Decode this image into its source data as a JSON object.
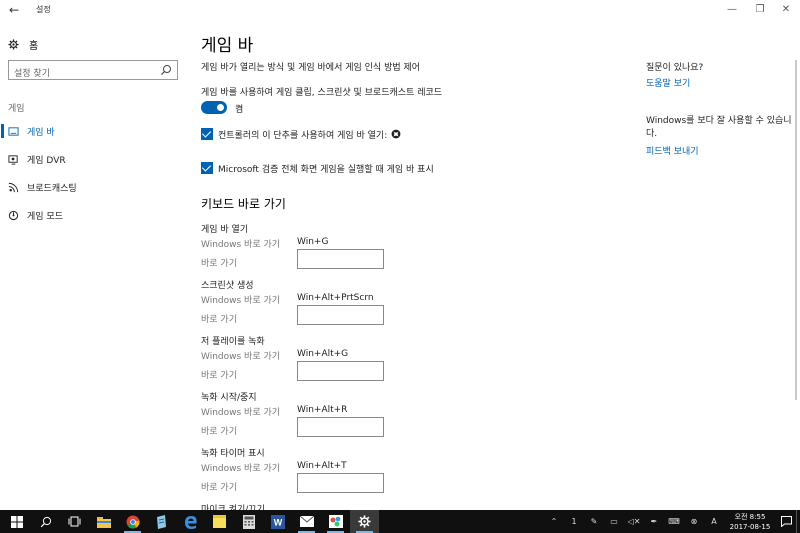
{
  "window": {
    "title": "설정"
  },
  "sidebar": {
    "home_label": "홈",
    "search_placeholder": "설정 찾기",
    "section_label": "게임",
    "items": [
      {
        "label": "게임 바",
        "icon": "game-bar-icon",
        "active": true
      },
      {
        "label": "게임 DVR",
        "icon": "game-dvr-icon",
        "active": false
      },
      {
        "label": "브로드캐스팅",
        "icon": "broadcast-icon",
        "active": false
      },
      {
        "label": "게임 모드",
        "icon": "game-mode-icon",
        "active": false
      }
    ]
  },
  "main": {
    "title": "게임 바",
    "description": "게임 바가 열리는 방식 및 게임 바에서 게임 인식 방법 제어",
    "record_toggle": {
      "label": "게임 바를 사용하여 게임 클립, 스크린샷 및 브로드캐스트 레코드",
      "state": "켬",
      "on": true
    },
    "checkbox_controller": {
      "label": "컨트롤러의 이 단추를 사용하여 게임 바 열기:",
      "checked": true
    },
    "checkbox_fullscreen": {
      "label": "Microsoft 검증 전체 화면 게임을 실행할 때 게임 바 표시",
      "checked": true
    },
    "shortcuts_title": "키보드 바로 가기",
    "windows_shortcut_label": "Windows 바로 가기",
    "custom_shortcut_label": "바로 가기",
    "shortcuts": [
      {
        "name": "게임 바 열기",
        "windows_key": "Win+G",
        "custom": ""
      },
      {
        "name": "스크린샷 생성",
        "windows_key": "Win+Alt+PrtScrn",
        "custom": ""
      },
      {
        "name": "저 플레이를 녹화",
        "windows_key": "Win+Alt+G",
        "custom": ""
      },
      {
        "name": "녹화 시작/중지",
        "windows_key": "Win+Alt+R",
        "custom": ""
      },
      {
        "name": "녹화 타이머 표시",
        "windows_key": "Win+Alt+T",
        "custom": ""
      },
      {
        "name": "마이크 켜기/끄기",
        "windows_key": "",
        "custom": ""
      }
    ]
  },
  "right_panel": {
    "question": "질문이 있나요?",
    "help_link": "도움말 보기",
    "improve_text": "Windows를 보다 잘 사용할 수 있습니다.",
    "feedback_link": "피드백 보내기"
  },
  "taskbar": {
    "apps": [
      "start-icon",
      "search-icon",
      "task-view-icon",
      "file-explorer-icon",
      "chrome-icon",
      "notepad-icon",
      "edge-icon",
      "sticky-notes-icon",
      "calculator-icon",
      "word-icon",
      "mail-icon",
      "paint-icon",
      "settings-icon"
    ],
    "tray_badge": "1",
    "clock_time": "오전 8:55",
    "clock_date": "2017-08-15"
  },
  "colors": {
    "accent": "#0063b1",
    "taskbar": "#101010"
  }
}
